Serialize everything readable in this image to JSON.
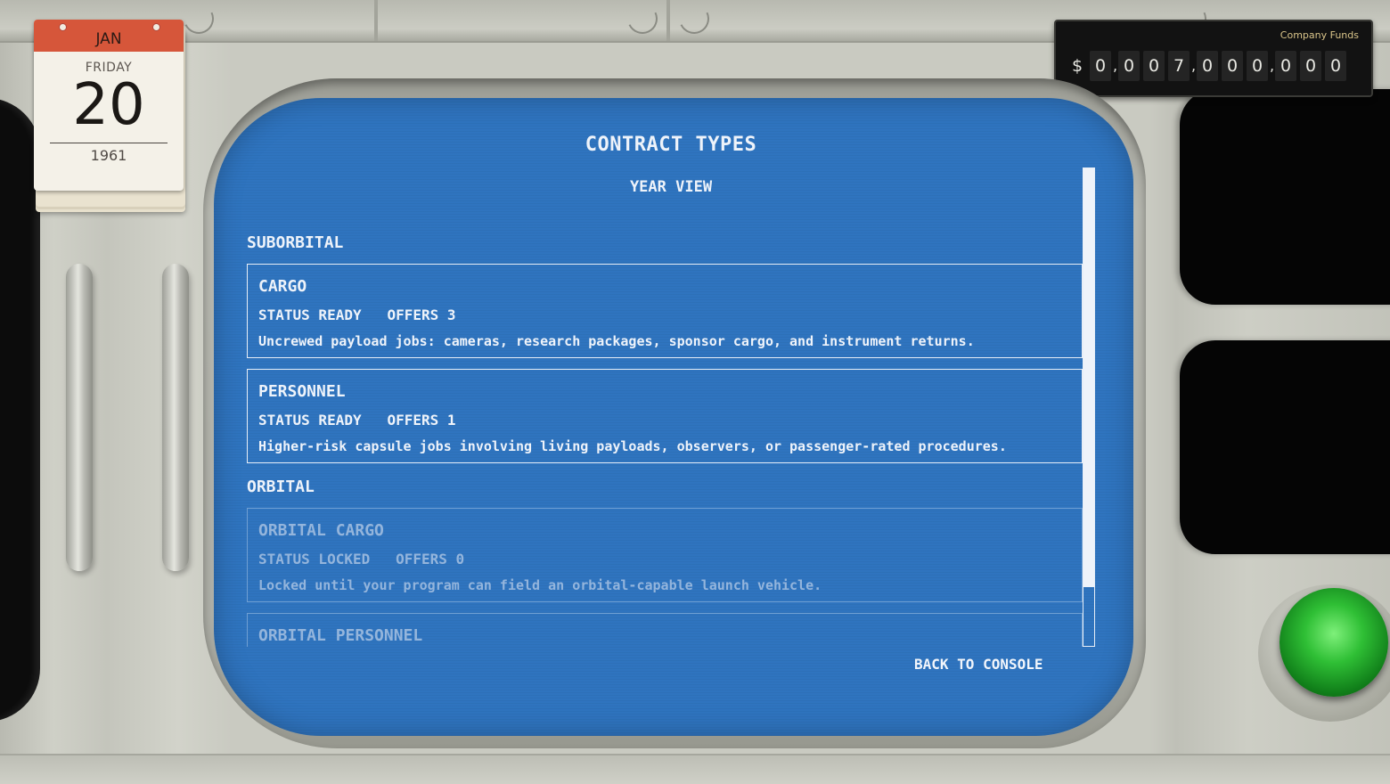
{
  "calendar": {
    "month": "JAN",
    "weekday": "FRIDAY",
    "day": "20",
    "year": "1961"
  },
  "funds": {
    "label": "Company Funds",
    "currency_symbol": "$",
    "digits": [
      "0",
      "0",
      "0",
      "7",
      "0",
      "0",
      "0",
      "0",
      "0",
      "0"
    ],
    "separator": ","
  },
  "screen": {
    "title": "CONTRACT TYPES",
    "subtitle": "YEAR VIEW",
    "sections": [
      {
        "label": "SUBORBITAL",
        "cards": [
          {
            "title": "CARGO",
            "meta": "STATUS READY   OFFERS 3",
            "description": "Uncrewed payload jobs: cameras, research packages, sponsor cargo, and instrument returns.",
            "locked": false
          },
          {
            "title": "PERSONNEL",
            "meta": "STATUS READY   OFFERS 1",
            "description": "Higher-risk capsule jobs involving living payloads, observers, or passenger-rated procedures.",
            "locked": false
          }
        ]
      },
      {
        "label": "ORBITAL",
        "cards": [
          {
            "title": "ORBITAL CARGO",
            "meta": "STATUS LOCKED   OFFERS 0",
            "description": "Locked until your program can field an orbital-capable launch vehicle.",
            "locked": true
          },
          {
            "title": "ORBITAL PERSONNEL",
            "meta": "",
            "description": "",
            "locked": true
          }
        ]
      }
    ],
    "back_label": "BACK TO CONSOLE"
  },
  "colors": {
    "screen_blue": "#2f74bf",
    "screen_text": "#eef3fa",
    "locked_text": "#94b5dc",
    "calendar_header": "#d6563a",
    "button_green": "#2fbf35"
  }
}
